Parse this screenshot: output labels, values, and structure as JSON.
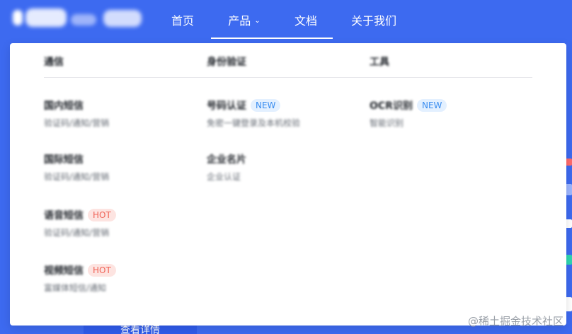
{
  "header": {
    "nav": [
      {
        "label": "首页",
        "active": false
      },
      {
        "label": "产品",
        "active": true,
        "has_dropdown": true
      },
      {
        "label": "文档",
        "active": false
      },
      {
        "label": "关于我们",
        "active": false
      }
    ],
    "caret_icon": "chevron-down-icon"
  },
  "dropdown": {
    "categories": [
      "通信",
      "身份验证",
      "工具"
    ],
    "items": [
      {
        "title": "国内短信",
        "desc": "验证码/通知/营销",
        "badge": ""
      },
      {
        "title": "号码认证",
        "desc": "免密一键登录及本机校验",
        "badge": "NEW"
      },
      {
        "title": "OCR识别",
        "desc": "智能识别",
        "badge": "NEW"
      },
      {
        "title": "国际短信",
        "desc": "验证码/通知/营销",
        "badge": ""
      },
      {
        "title": "企业名片",
        "desc": "企业认证",
        "badge": ""
      },
      {
        "title": "语音短信",
        "desc": "验证码/通知/营销",
        "badge": "HOT"
      },
      {
        "title": "视频短信",
        "desc": "富媒体短信/通知",
        "badge": "HOT"
      }
    ]
  },
  "footer_button": "查看详情",
  "watermark": "@稀土掘金技术社区",
  "colors": {
    "brand": "#3d6af0",
    "new_badge": "#3b8ef0",
    "hot_badge": "#f06457"
  }
}
